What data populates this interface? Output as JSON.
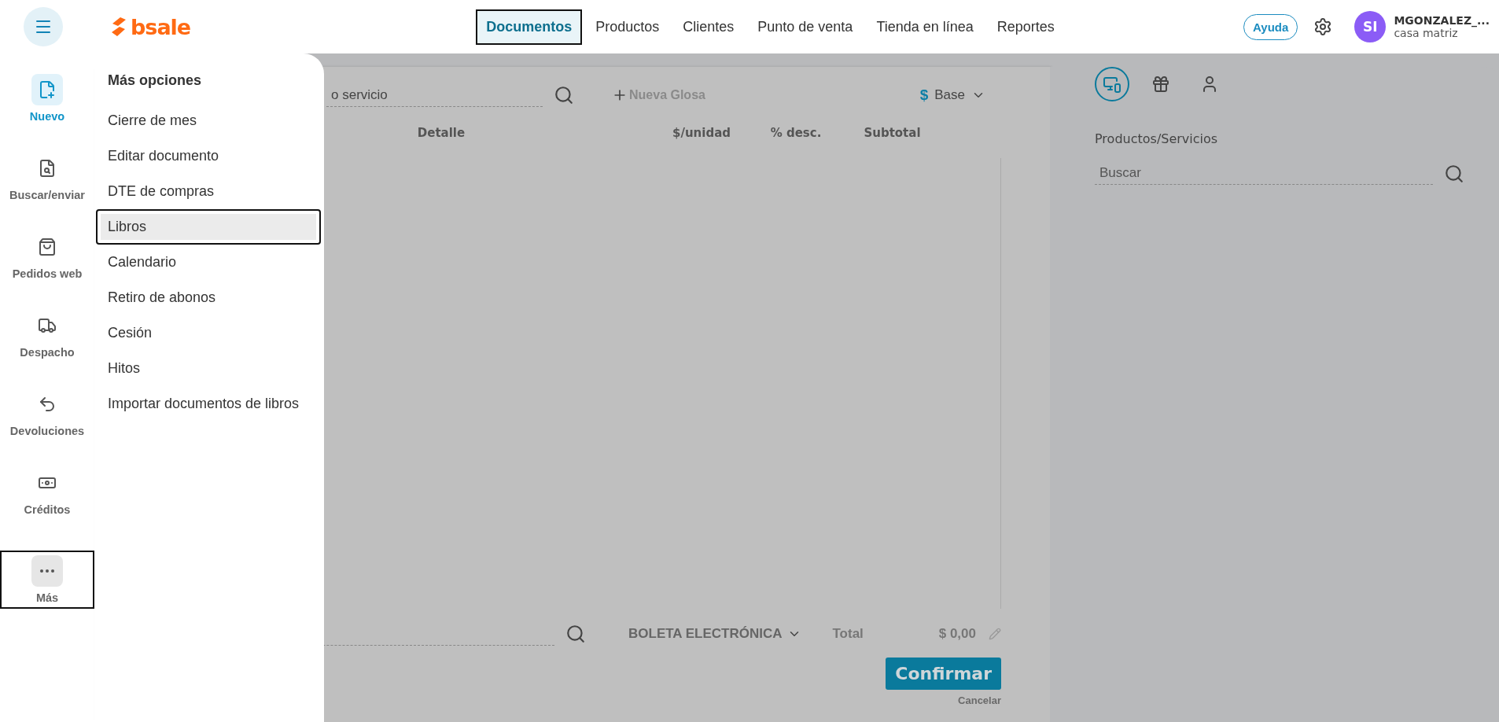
{
  "topbar": {
    "logo": "bsale",
    "nav": [
      {
        "label": "Documentos",
        "selected": true
      },
      {
        "label": "Productos",
        "selected": false
      },
      {
        "label": "Clientes",
        "selected": false
      },
      {
        "label": "Punto de venta",
        "selected": false
      },
      {
        "label": "Tienda en línea",
        "selected": false
      },
      {
        "label": "Reportes",
        "selected": false
      }
    ],
    "help_button": "Ayuda",
    "user": {
      "initials": "SI",
      "name": "MGONZALEZ_...",
      "branch": "casa matriz"
    }
  },
  "sidebar": {
    "items": [
      {
        "label": "Nuevo",
        "active": true,
        "selected": false
      },
      {
        "label": "Buscar/enviar",
        "active": false,
        "selected": false
      },
      {
        "label": "Pedidos web",
        "active": false,
        "selected": false
      },
      {
        "label": "Despacho",
        "active": false,
        "selected": false
      },
      {
        "label": "Devoluciones",
        "active": false,
        "selected": false
      },
      {
        "label": "Créditos",
        "active": false,
        "selected": false
      },
      {
        "label": "Más",
        "active": false,
        "selected": true
      }
    ]
  },
  "more_menu": {
    "title": "Más opciones",
    "items": [
      {
        "label": "Cierre de mes",
        "selected": false
      },
      {
        "label": "Editar documento",
        "selected": false
      },
      {
        "label": "DTE de compras",
        "selected": false
      },
      {
        "label": "Libros",
        "selected": true
      },
      {
        "label": "Calendario",
        "selected": false
      },
      {
        "label": "Retiro de abonos",
        "selected": false
      },
      {
        "label": "Cesión",
        "selected": false
      },
      {
        "label": "Hitos",
        "selected": false
      },
      {
        "label": "Importar documentos de libros",
        "selected": false
      }
    ]
  },
  "document": {
    "product_search": {
      "value": "o servicio"
    },
    "new_gloss": "Nueva Glosa",
    "currency_symbol": "$",
    "price_list": "Base",
    "columns": [
      "Detalle",
      "$/unidad",
      "% desc.",
      "Subtotal"
    ],
    "document_type": "BOLETA ELECTRÓNICA",
    "total_label": "Total",
    "total_value": "$ 0,00",
    "confirm_button": "Confirmar",
    "cancel_link": "Cancelar"
  },
  "right_panel": {
    "tabs": [
      {
        "selected": true
      },
      {
        "selected": false
      },
      {
        "selected": false
      }
    ],
    "title": "Productos/Servicios",
    "search": {
      "placeholder": "Buscar"
    }
  }
}
